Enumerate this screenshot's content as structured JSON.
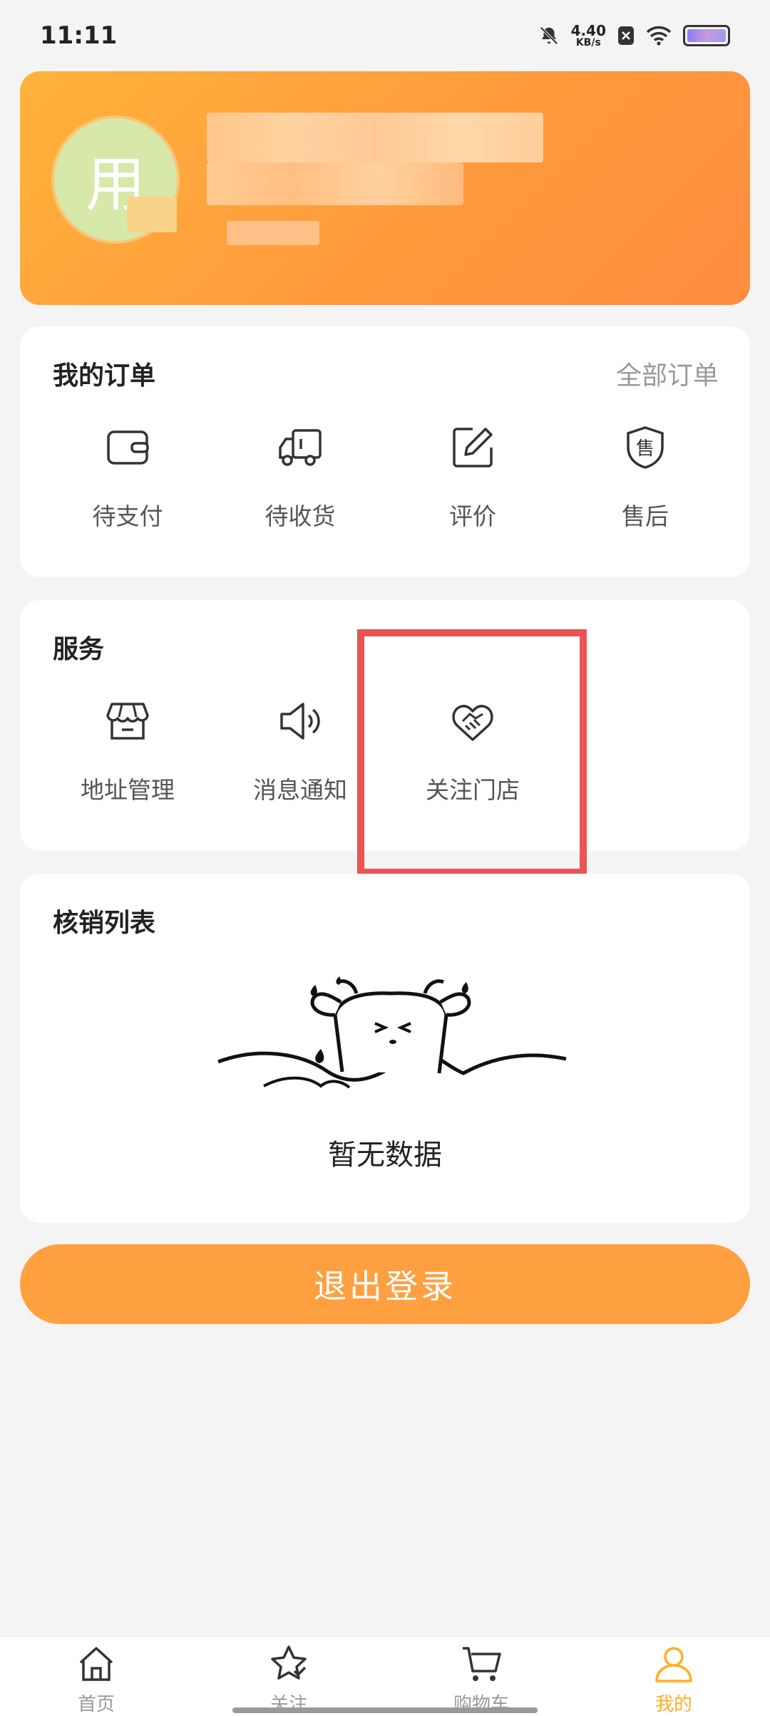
{
  "status": {
    "time": "11:11",
    "net_speed_value": "4.40",
    "net_speed_unit": "KB/s"
  },
  "profile": {
    "avatar_char": "用"
  },
  "orders": {
    "title": "我的订单",
    "all_link": "全部订单",
    "items": [
      {
        "label": "待支付",
        "icon": "wallet-icon"
      },
      {
        "label": "待收货",
        "icon": "truck-icon"
      },
      {
        "label": "评价",
        "icon": "edit-icon"
      },
      {
        "label": "售后",
        "icon": "after-sales-shield-icon",
        "glyph": "售"
      }
    ]
  },
  "services": {
    "title": "服务",
    "items": [
      {
        "label": "地址管理",
        "icon": "store-icon"
      },
      {
        "label": "消息通知",
        "icon": "speaker-icon"
      },
      {
        "label": "关注门店",
        "icon": "handshake-heart-icon"
      }
    ]
  },
  "verification": {
    "title": "核销列表",
    "empty_text": "暂无数据"
  },
  "logout_label": "退出登录",
  "nav": {
    "items": [
      {
        "label": "首页",
        "icon": "home-icon"
      },
      {
        "label": "关注",
        "icon": "star-icon"
      },
      {
        "label": "购物车",
        "icon": "cart-icon"
      },
      {
        "label": "我的",
        "icon": "user-icon",
        "active": true
      }
    ]
  },
  "colors": {
    "accent": "#ffa040",
    "header_gradient_start": "#ffb33b",
    "header_gradient_end": "#ff8d40",
    "nav_active": "#ffae24",
    "highlight": "#ea5453"
  }
}
